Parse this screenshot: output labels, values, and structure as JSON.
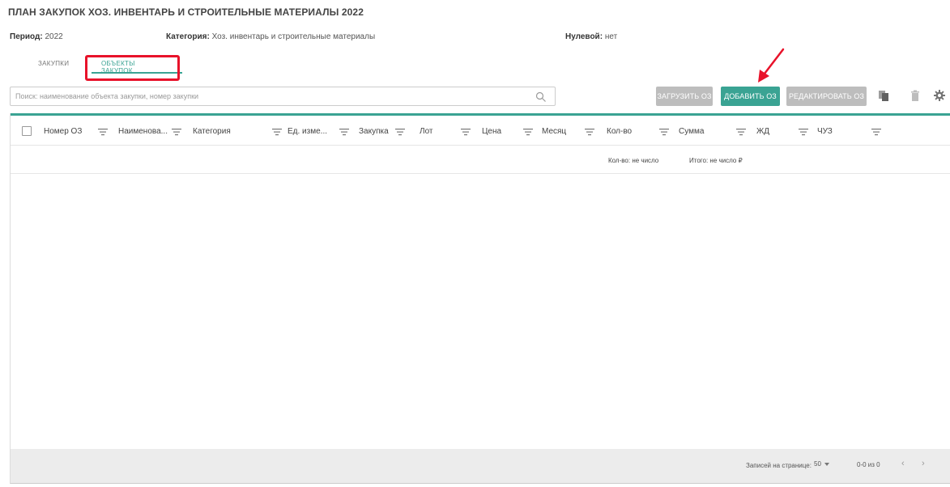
{
  "page": {
    "title": "ПЛАН ЗАКУПОК ХОЗ. ИНВЕНТАРЬ И СТРОИТЕЛЬНЫЕ МАТЕРИАЛЫ 2022"
  },
  "meta": {
    "period_label": "Период:",
    "period_value": "2022",
    "category_label": "Категория:",
    "category_value": "Хоз. инвентарь и строительные материалы",
    "zero_label": "Нулевой:",
    "zero_value": "нет"
  },
  "tabs": [
    {
      "label": "ЗАКУПКИ",
      "active": false
    },
    {
      "label": "ОБЪЕКТЫ ЗАКУПОК",
      "active": true
    }
  ],
  "search": {
    "placeholder": "Поиск: наименование объекта закупки, номер закупки",
    "value": ""
  },
  "toolbar": {
    "upload_label": "ЗАГРУЗИТЬ ОЗ",
    "add_label": "ДОБАВИТЬ ОЗ",
    "edit_label": "РЕДАКТИРОВАТЬ ОЗ"
  },
  "table": {
    "columns": [
      "Номер ОЗ",
      "Наименова...",
      "Категория",
      "Ед. изме...",
      "Закупка",
      "Лот",
      "Цена",
      "Месяц",
      "Кол-во",
      "Сумма",
      "ЖД",
      "ЧУЗ"
    ],
    "rows": [],
    "totals": {
      "qty": "Кол-во: не число",
      "sum": "Итого: не число ₽"
    }
  },
  "pagination": {
    "per_page_label": "Записей на странице:",
    "per_page_value": "50",
    "range": "0-0 из 0"
  },
  "colors": {
    "accent": "#3aa393",
    "highlight": "#e8122a",
    "disabled": "#bdbdbd"
  }
}
